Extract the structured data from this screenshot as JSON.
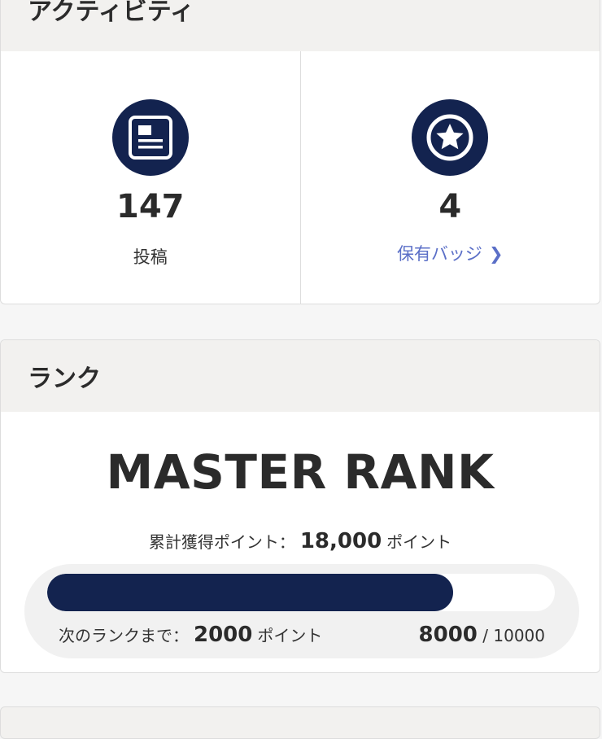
{
  "activity": {
    "title": "アクティビティ",
    "posts": {
      "count": "147",
      "label": "投稿",
      "icon": "document-icon"
    },
    "badges": {
      "count": "4",
      "link_label": "保有バッジ",
      "chevron": "❯",
      "icon": "star-badge-icon"
    }
  },
  "rank": {
    "title": "ランク",
    "name": "MASTER RANK",
    "total_points_label": "累計獲得ポイント：",
    "total_points_value": "18,000",
    "total_points_unit": "ポイント",
    "progress_fraction": 0.8,
    "next_label": "次のランクまで：",
    "next_value": "2000",
    "next_unit": "ポイント",
    "current": "8000",
    "separator": "/",
    "target": "10000"
  },
  "colors": {
    "navy": "#13234f",
    "link": "#5b6fc7",
    "header_bg": "#f2f1ef"
  }
}
